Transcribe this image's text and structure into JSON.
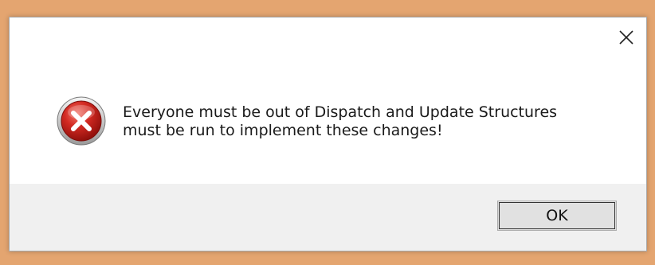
{
  "dialog": {
    "message_line1": "Everyone must be out of Dispatch and Update Structures",
    "message_line2": "must be run to implement these changes!",
    "ok_label": "OK",
    "icon": "error-icon",
    "close_icon": "close-icon"
  },
  "colors": {
    "background": "#e4a570",
    "dialog": "#ffffff",
    "footer": "#f0f0f0",
    "error_red": "#c91f1f"
  }
}
